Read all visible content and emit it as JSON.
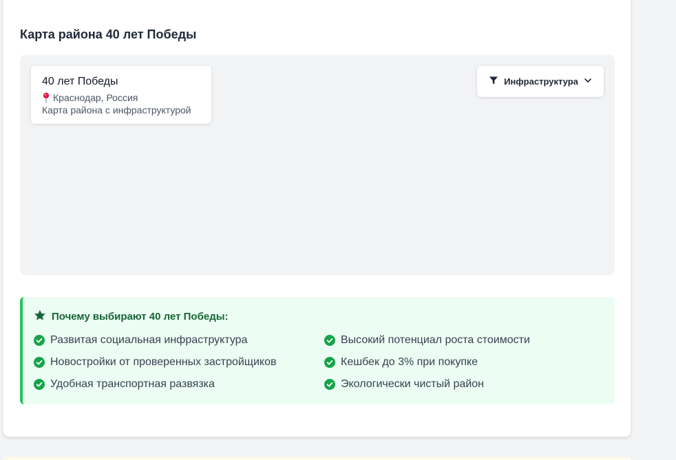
{
  "section": {
    "title": "Карта района 40 лет Победы"
  },
  "map": {
    "info": {
      "title": "40 лет Победы",
      "location": "Краснодар, Россия",
      "description": "Карта района с инфраструктурой"
    },
    "filter": {
      "label": "Инфраструктура"
    }
  },
  "why": {
    "title": "Почему выбирают 40 лет Победы:",
    "items": [
      "Развитая социальная инфраструктура",
      "Высокий потенциал роста стоимости",
      "Новостройки от проверенных застройщиков",
      "Кешбек до 3% при покупке",
      "Удобная транспортная развязка",
      "Экологически чистый район"
    ]
  },
  "icons": {
    "pin": "pin-icon",
    "filter": "filter-icon",
    "chevron": "chevron-down-icon",
    "star": "star-icon",
    "check": "check-circle-icon"
  },
  "colors": {
    "accent_green": "#22c55e",
    "title_green": "#166534",
    "pin_red": "#e11d48",
    "map_bg": "#f2f3f5"
  }
}
